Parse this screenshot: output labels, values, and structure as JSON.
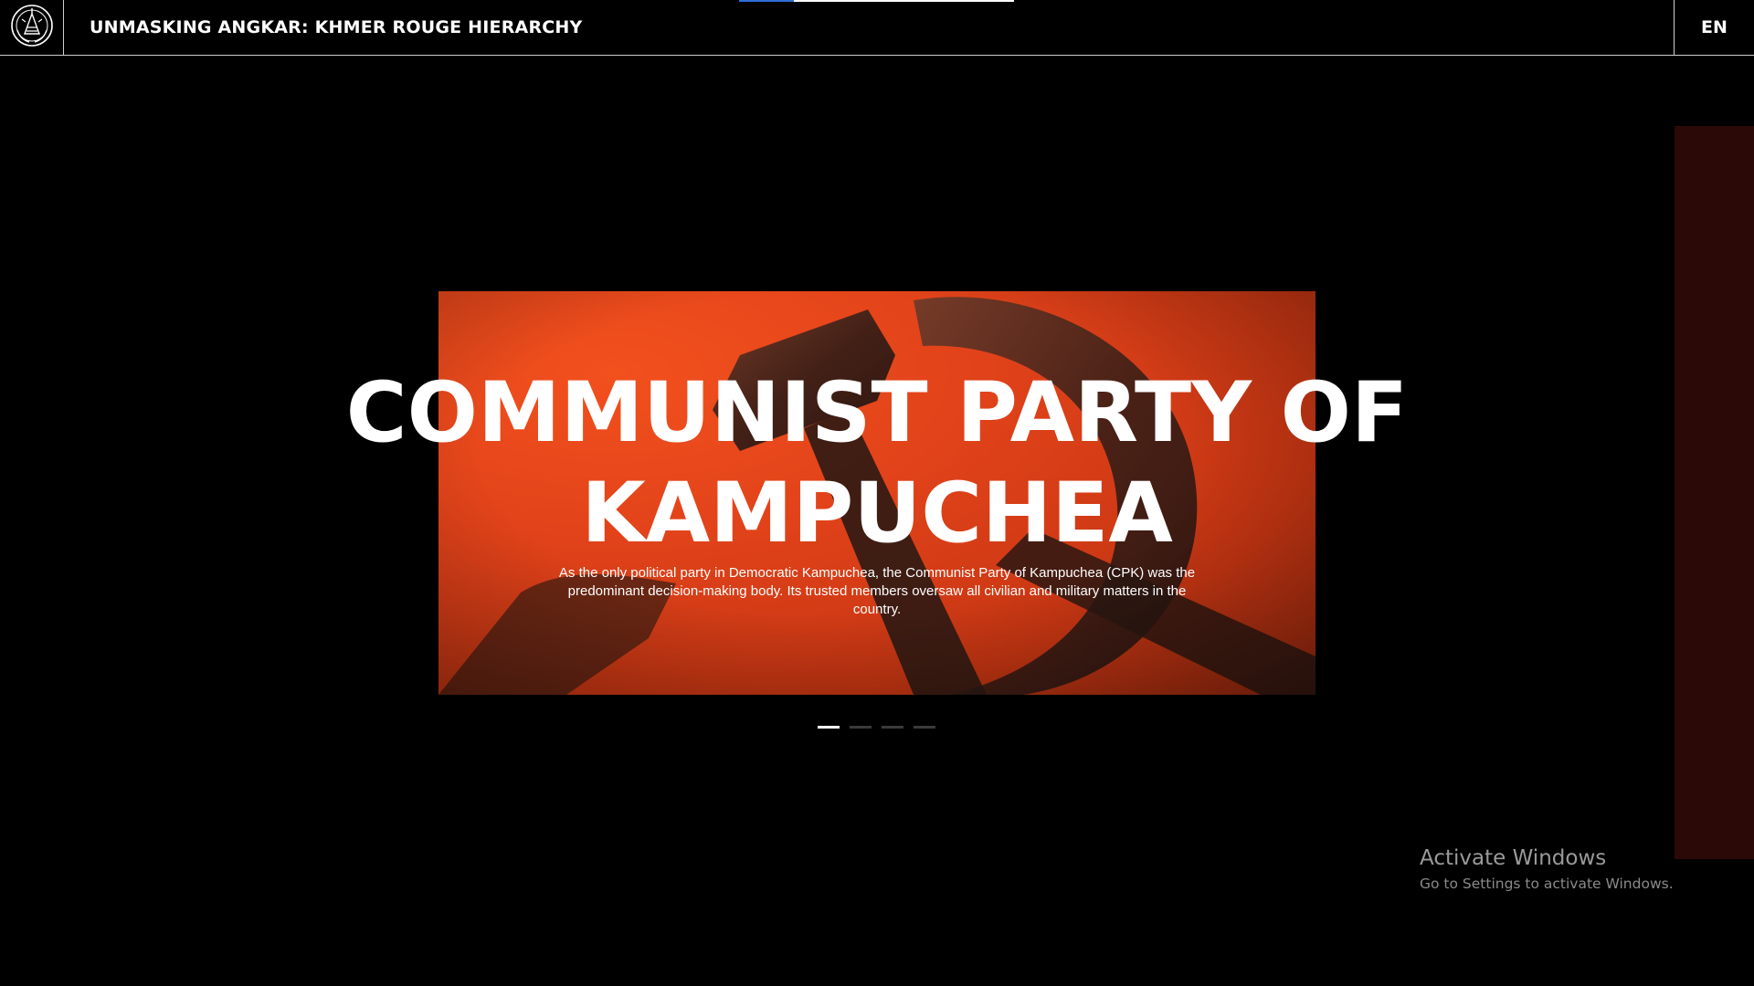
{
  "header": {
    "title": "UNMASKING ANGKAR: KHMER ROUGE HIERARCHY",
    "language": "EN",
    "logo_icon": "emblem-icon",
    "reading_progress": 0.2
  },
  "slide": {
    "title": "COMMUNIST PARTY OF KAMPUCHEA",
    "description": "As the only political party in Democratic Kampuchea, the Communist Party of Kampuchea (CPK) was the predominant decision-making body. Its trusted members oversaw all civilian and military matters in the country.",
    "image_icon": "hammer-and-sickle-icon"
  },
  "carousel": {
    "total": 4,
    "active_index": 0
  },
  "watermark": {
    "title": "Activate Windows",
    "subtitle": "Go to Settings to activate Windows."
  },
  "colors": {
    "slide_red": "#e2431a",
    "side_panel": "#2a0906",
    "progress_accent": "#2f6fd8"
  }
}
